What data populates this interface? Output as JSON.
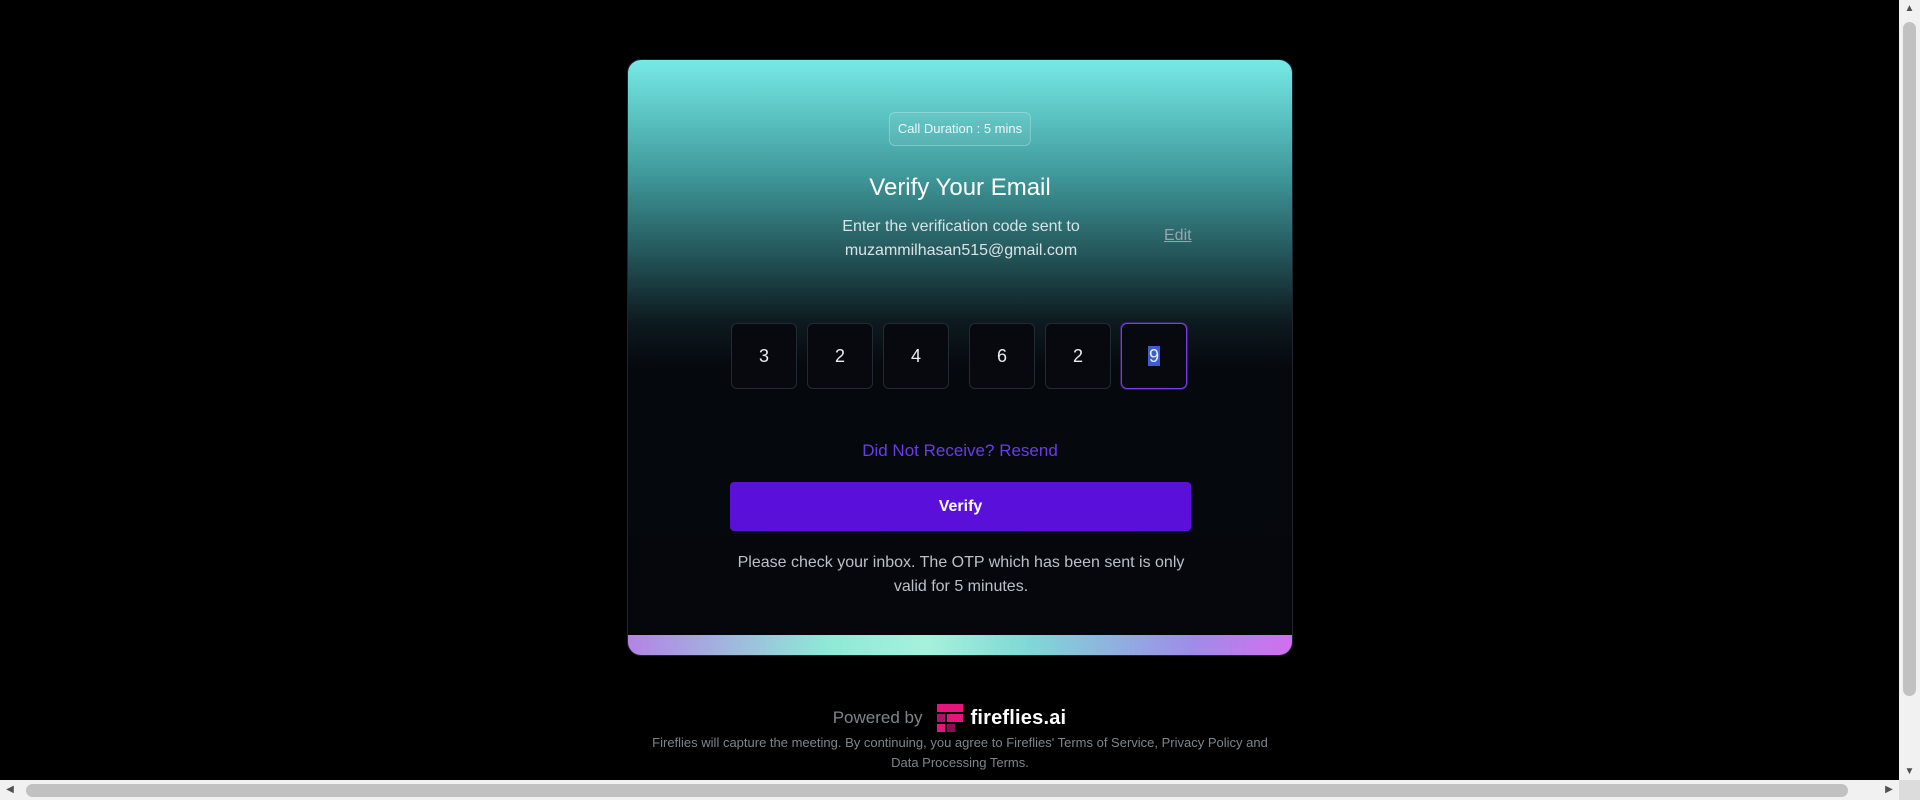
{
  "header": {
    "call_duration": "Call Duration : 5 mins"
  },
  "verify": {
    "title": "Verify Your Email",
    "subtitle_line1": "Enter the verification code sent to",
    "email": "muzammilhasan515@gmail.com",
    "edit_label": "Edit",
    "otp_digits": [
      "3",
      "2",
      "4",
      "6",
      "2",
      "9"
    ],
    "active_index": 5,
    "resend_label": "Did Not Receive? Resend",
    "verify_label": "Verify",
    "info_text": "Please check your inbox. The OTP which has been sent is only valid for 5 minutes."
  },
  "footer": {
    "powered_by": "Powered by",
    "brand_name": "fireflies.ai",
    "legal": "Fireflies will capture the meeting. By continuing, you agree to Fireflies' Terms of Service, Privacy Policy and Data Processing Terms."
  },
  "colors": {
    "accent": "#5a10d8",
    "link": "#6a3ce8",
    "brand_logo": "#e6147d"
  },
  "icons": {
    "brand": "fireflies-logo-icon",
    "scroll_up": "triangle-up-icon",
    "scroll_down": "triangle-down-icon",
    "scroll_left": "triangle-left-icon",
    "scroll_right": "triangle-right-icon"
  }
}
